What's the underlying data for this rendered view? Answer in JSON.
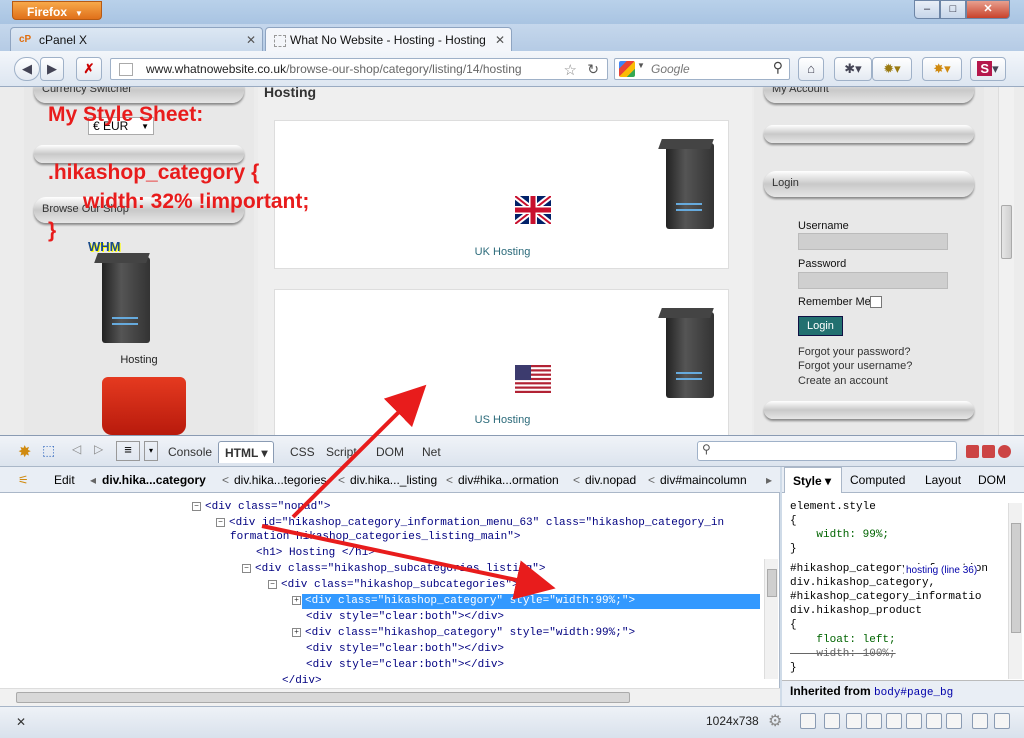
{
  "browser": {
    "app_button": "Firefox",
    "window_controls": {
      "minimize": "–",
      "maximize": "□",
      "close": "✕"
    },
    "tabs": [
      {
        "label": "cPanel X",
        "icon": "cpanel-icon"
      },
      {
        "label": "What No Website - Hosting - Hosting",
        "icon": "page-icon"
      }
    ],
    "new_tab": "+",
    "url_host": "www.whatnowebsite.co.uk",
    "url_path": "/browse-our-shop/category/listing/14/hosting",
    "search_placeholder": "Google"
  },
  "page": {
    "left": {
      "module1_title": "Currency Switcher",
      "currency_value": "€ EUR",
      "module2_title": "Browse Our Shop",
      "hosting_label": "Hosting"
    },
    "annotation_text": "My Style Sheet:\n\n.hikashop_category {\n      width: 32% !important;\n}",
    "main": {
      "title": "Hosting",
      "categories": [
        {
          "label": "UK Hosting",
          "flag": "uk-flag"
        },
        {
          "label": "US Hosting",
          "flag": "us-flag"
        }
      ]
    },
    "right": {
      "module1_title": "My Account",
      "login_title": "Login",
      "username_label": "Username",
      "password_label": "Password",
      "remember_label": "Remember Me",
      "login_button": "Login",
      "forgot_password": "Forgot your password?",
      "forgot_username": "Forgot your username?",
      "create_account": "Create an account"
    }
  },
  "firebug": {
    "tabs": [
      "Console",
      "HTML ▾",
      "CSS",
      "Script",
      "DOM",
      "Net"
    ],
    "edit_label": "Edit",
    "breadcrumbs": [
      "div.hika...category",
      "div.hika...tegories",
      "div.hika..._listing",
      "div#hika...ormation",
      "div.nopad",
      "div#maincolumn"
    ],
    "side_tabs": [
      "Style ▾",
      "Computed",
      "Layout",
      "DOM"
    ],
    "html_lines": [
      "<div class=\"nopad\">",
      "<div id=\"hikashop_category_information_menu_63\" class=\"hikashop_category_in",
      "formation hikashop_categories_listing_main\">",
      "<h1> Hosting </h1>",
      "<div class=\"hikashop_subcategories_listing\">",
      "<div class=\"hikashop_subcategories\">",
      "<div class=\"hikashop_category\" style=\"width:99%;\">",
      "<div style=\"clear:both\"></div>",
      "<div class=\"hikashop_category\" style=\"width:99%;\">",
      "<div style=\"clear:both\"></div>",
      "<div style=\"clear:both\"></div>",
      "</div>"
    ],
    "style_lines": [
      "element.style",
      "{",
      "    width: 99%;",
      "}",
      "#hikashop_category_information",
      "div.hikashop_category,",
      "#hikashop_category_informatio",
      "div.hikashop_product",
      "{",
      "    float: left;",
      "    width: 100%;",
      "}"
    ],
    "style_source": "hosting (line 36)",
    "inherited_label": "Inherited from",
    "inherited_from": "body#page_bg"
  },
  "status": {
    "close": "✕",
    "size": "1024x738"
  }
}
